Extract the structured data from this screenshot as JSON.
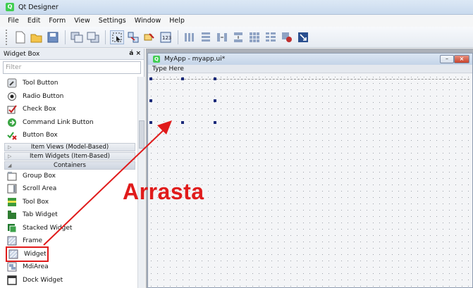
{
  "app": {
    "title": "Qt Designer",
    "logo_glyph": "Q"
  },
  "menu": [
    "File",
    "Edit",
    "Form",
    "View",
    "Settings",
    "Window",
    "Help"
  ],
  "toolbar": {
    "icons": [
      "new-file-icon",
      "open-file-icon",
      "save-icon",
      "send-to-back-icon",
      "bring-to-front-icon",
      "edit-widgets-icon",
      "edit-signals-slots-icon",
      "edit-buddies-icon",
      "edit-tab-order-icon",
      "layout-horizontal-icon",
      "layout-vertical-icon",
      "layout-horizontal-splitter-icon",
      "layout-vertical-splitter-icon",
      "layout-grid-icon",
      "layout-form-icon",
      "break-layout-icon",
      "adjust-size-icon"
    ]
  },
  "widget_box": {
    "title": "Widget Box",
    "title_controls": "á ×",
    "filter_placeholder": "Filter",
    "items_top": [
      {
        "label": "Tool Button",
        "icon": "tool-button-icon"
      },
      {
        "label": "Radio Button",
        "icon": "radio-button-icon"
      },
      {
        "label": "Check Box",
        "icon": "check-box-icon"
      },
      {
        "label": "Command Link Button",
        "icon": "command-link-icon"
      },
      {
        "label": "Button Box",
        "icon": "button-box-icon"
      }
    ],
    "categories": [
      {
        "label": "Item Views (Model-Based)",
        "arrow": "▷"
      },
      {
        "label": "Item Widgets (Item-Based)",
        "arrow": "▷"
      },
      {
        "label": "Containers",
        "arrow": "◢"
      }
    ],
    "items_containers": [
      {
        "label": "Group Box",
        "icon": "group-box-icon"
      },
      {
        "label": "Scroll Area",
        "icon": "scroll-area-icon"
      },
      {
        "label": "Tool Box",
        "icon": "tool-box-icon"
      },
      {
        "label": "Tab Widget",
        "icon": "tab-widget-icon"
      },
      {
        "label": "Stacked Widget",
        "icon": "stacked-widget-icon"
      },
      {
        "label": "Frame",
        "icon": "frame-icon"
      },
      {
        "label": "Widget",
        "icon": "widget-icon"
      },
      {
        "label": "MdiArea",
        "icon": "mdi-area-icon"
      },
      {
        "label": "Dock Widget",
        "icon": "dock-widget-icon"
      }
    ]
  },
  "form": {
    "title": "MyApp - myapp.ui*",
    "menu_placeholder": "Type Here",
    "min_glyph": "–",
    "close_glyph": "×"
  },
  "annotation": {
    "text": "Arrasta",
    "color": "#e01b1b"
  }
}
